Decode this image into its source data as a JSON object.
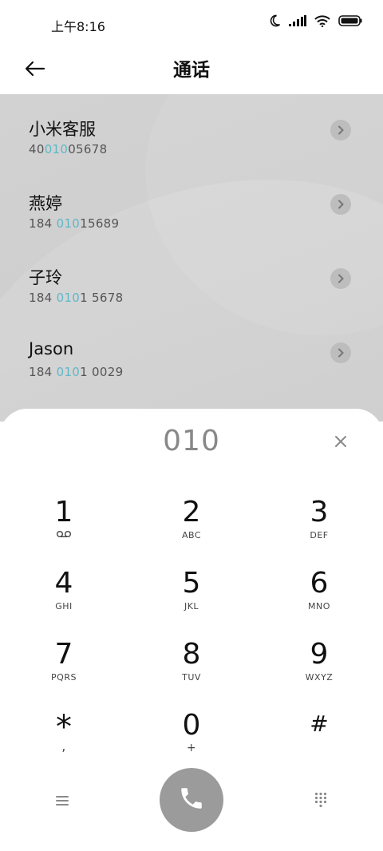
{
  "status_bar": {
    "time": "上午8:16"
  },
  "header": {
    "title": "通话"
  },
  "results": [
    {
      "name": "小米客服",
      "num_before": "40",
      "num_match": "010",
      "num_after": "05678"
    },
    {
      "name": "燕婷",
      "num_before": "184 ",
      "num_match": "010",
      "num_after": "15689"
    },
    {
      "name": "子玲",
      "num_before": "184 ",
      "num_match": "010",
      "num_after": "1 5678"
    },
    {
      "name": "Jason",
      "num_before": "184 ",
      "num_match": "010",
      "num_after": "1 0029"
    }
  ],
  "dialer": {
    "input": "010",
    "keys": [
      {
        "digit": "1",
        "letters": ""
      },
      {
        "digit": "2",
        "letters": "ABC"
      },
      {
        "digit": "3",
        "letters": "DEF"
      },
      {
        "digit": "4",
        "letters": "GHI"
      },
      {
        "digit": "5",
        "letters": "JKL"
      },
      {
        "digit": "6",
        "letters": "MNO"
      },
      {
        "digit": "7",
        "letters": "PQRS"
      },
      {
        "digit": "8",
        "letters": "TUV"
      },
      {
        "digit": "9",
        "letters": "WXYZ"
      },
      {
        "digit": "*",
        "letters": ","
      },
      {
        "digit": "0",
        "letters": "+"
      },
      {
        "digit": "#",
        "letters": ""
      }
    ]
  },
  "colors": {
    "highlight": "#5fb7c8",
    "call_button": "#9b9b9b"
  }
}
